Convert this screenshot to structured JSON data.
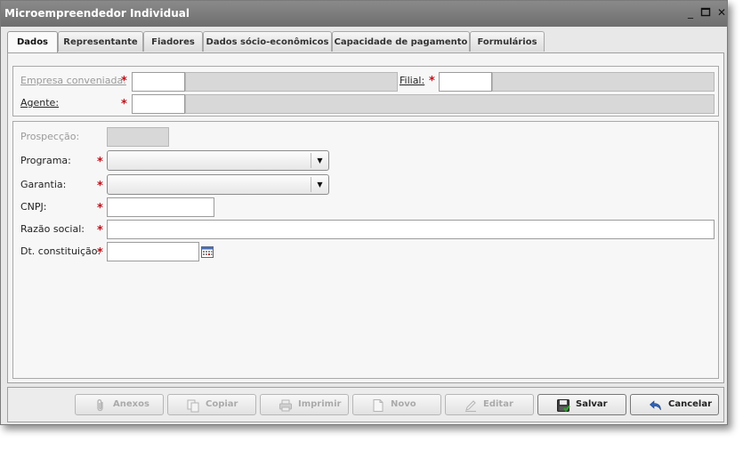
{
  "window": {
    "title": "Microempreendedor Individual"
  },
  "tabs": [
    {
      "label": "Dados"
    },
    {
      "label": "Representante"
    },
    {
      "label": "Fiadores"
    },
    {
      "label": "Dados sócio-econômicos"
    },
    {
      "label": "Capacidade de pagamento"
    },
    {
      "label": "Formulários"
    }
  ],
  "header_group": {
    "empresa_label": "Empresa conveniada:",
    "filial_label": "Filial:",
    "agente_label": "Agente:"
  },
  "form": {
    "prospeccao_label": "Prospecção:",
    "programa_label": "Programa:",
    "garantia_label": "Garantia:",
    "cnpj_label": "CNPJ:",
    "razao_label": "Razão social:",
    "dt_label": "Dt. constituição:",
    "required_mark": "*"
  },
  "buttons": {
    "anexos": "Anexos",
    "copiar": "Copiar",
    "imprimir": "Imprimir",
    "novo": "Novo",
    "editar": "Editar",
    "salvar": "Salvar",
    "cancelar": "Cancelar"
  }
}
